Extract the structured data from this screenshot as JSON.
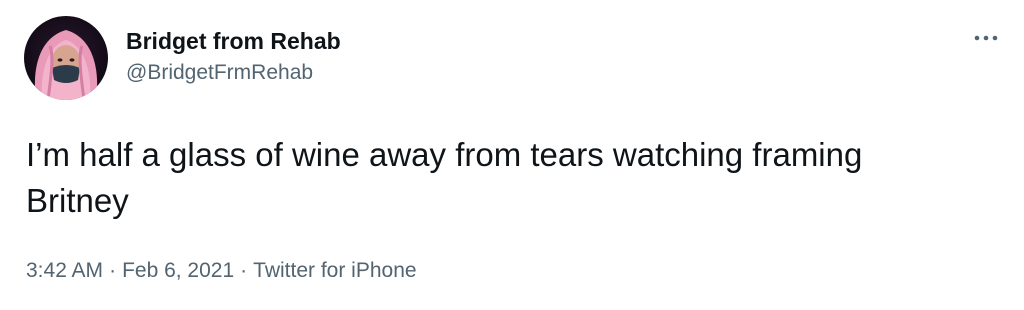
{
  "author": {
    "display_name": "Bridget from Rehab",
    "handle": "@BridgetFrmRehab",
    "avatar_icon": "profile-photo"
  },
  "tweet": {
    "text": "I’m half a glass of wine away from tears watching framing\nBritney"
  },
  "meta": {
    "time": "3:42 AM",
    "date": "Feb 6, 2021",
    "source": "Twitter for iPhone",
    "separator": "·"
  },
  "actions": {
    "more_icon": "more-options-icon"
  },
  "colors": {
    "text_primary": "#0f1419",
    "text_secondary": "#536471",
    "background": "#ffffff"
  }
}
